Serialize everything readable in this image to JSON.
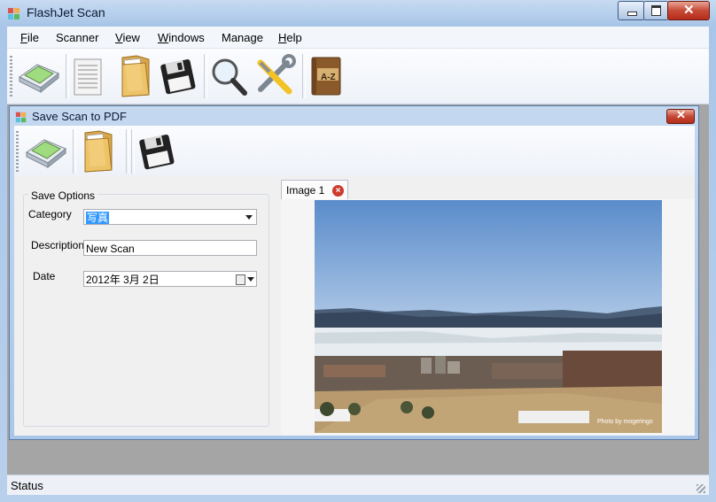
{
  "app": {
    "title": "FlashJet Scan"
  },
  "menu": [
    {
      "accel": "F",
      "rest": "ile"
    },
    {
      "accel": "",
      "rest": "Scanner"
    },
    {
      "accel": "V",
      "rest": "iew"
    },
    {
      "accel": "W",
      "rest": "indows"
    },
    {
      "accel": "",
      "rest": "Manage"
    },
    {
      "accel": "H",
      "rest": "elp"
    }
  ],
  "toolbar": {
    "icons": [
      "scanner-icon",
      "document-icon",
      "folder-icon",
      "save-disk-icon",
      "magnifier-icon",
      "tools-icon",
      "address-book-icon"
    ],
    "az_label": "A-Z"
  },
  "child": {
    "title": "Save Scan to PDF",
    "toolbar_icons": [
      "scanner-icon",
      "folder-icon",
      "save-disk-icon"
    ]
  },
  "save_options": {
    "legend": "Save Options",
    "category_label": "Category",
    "category_value": "写真",
    "description_label": "Description",
    "description_value": "New Scan",
    "date_label": "Date",
    "date_value": "2012年  3月  2日"
  },
  "tabs": [
    {
      "label": "Image 1"
    }
  ],
  "photo": {
    "credit": "Photo by mogeringo"
  },
  "status": {
    "text": "Status"
  },
  "colors": {
    "title_accent": "#a9c6e8",
    "close_red": "#c64a36",
    "selection": "#3399ff"
  }
}
